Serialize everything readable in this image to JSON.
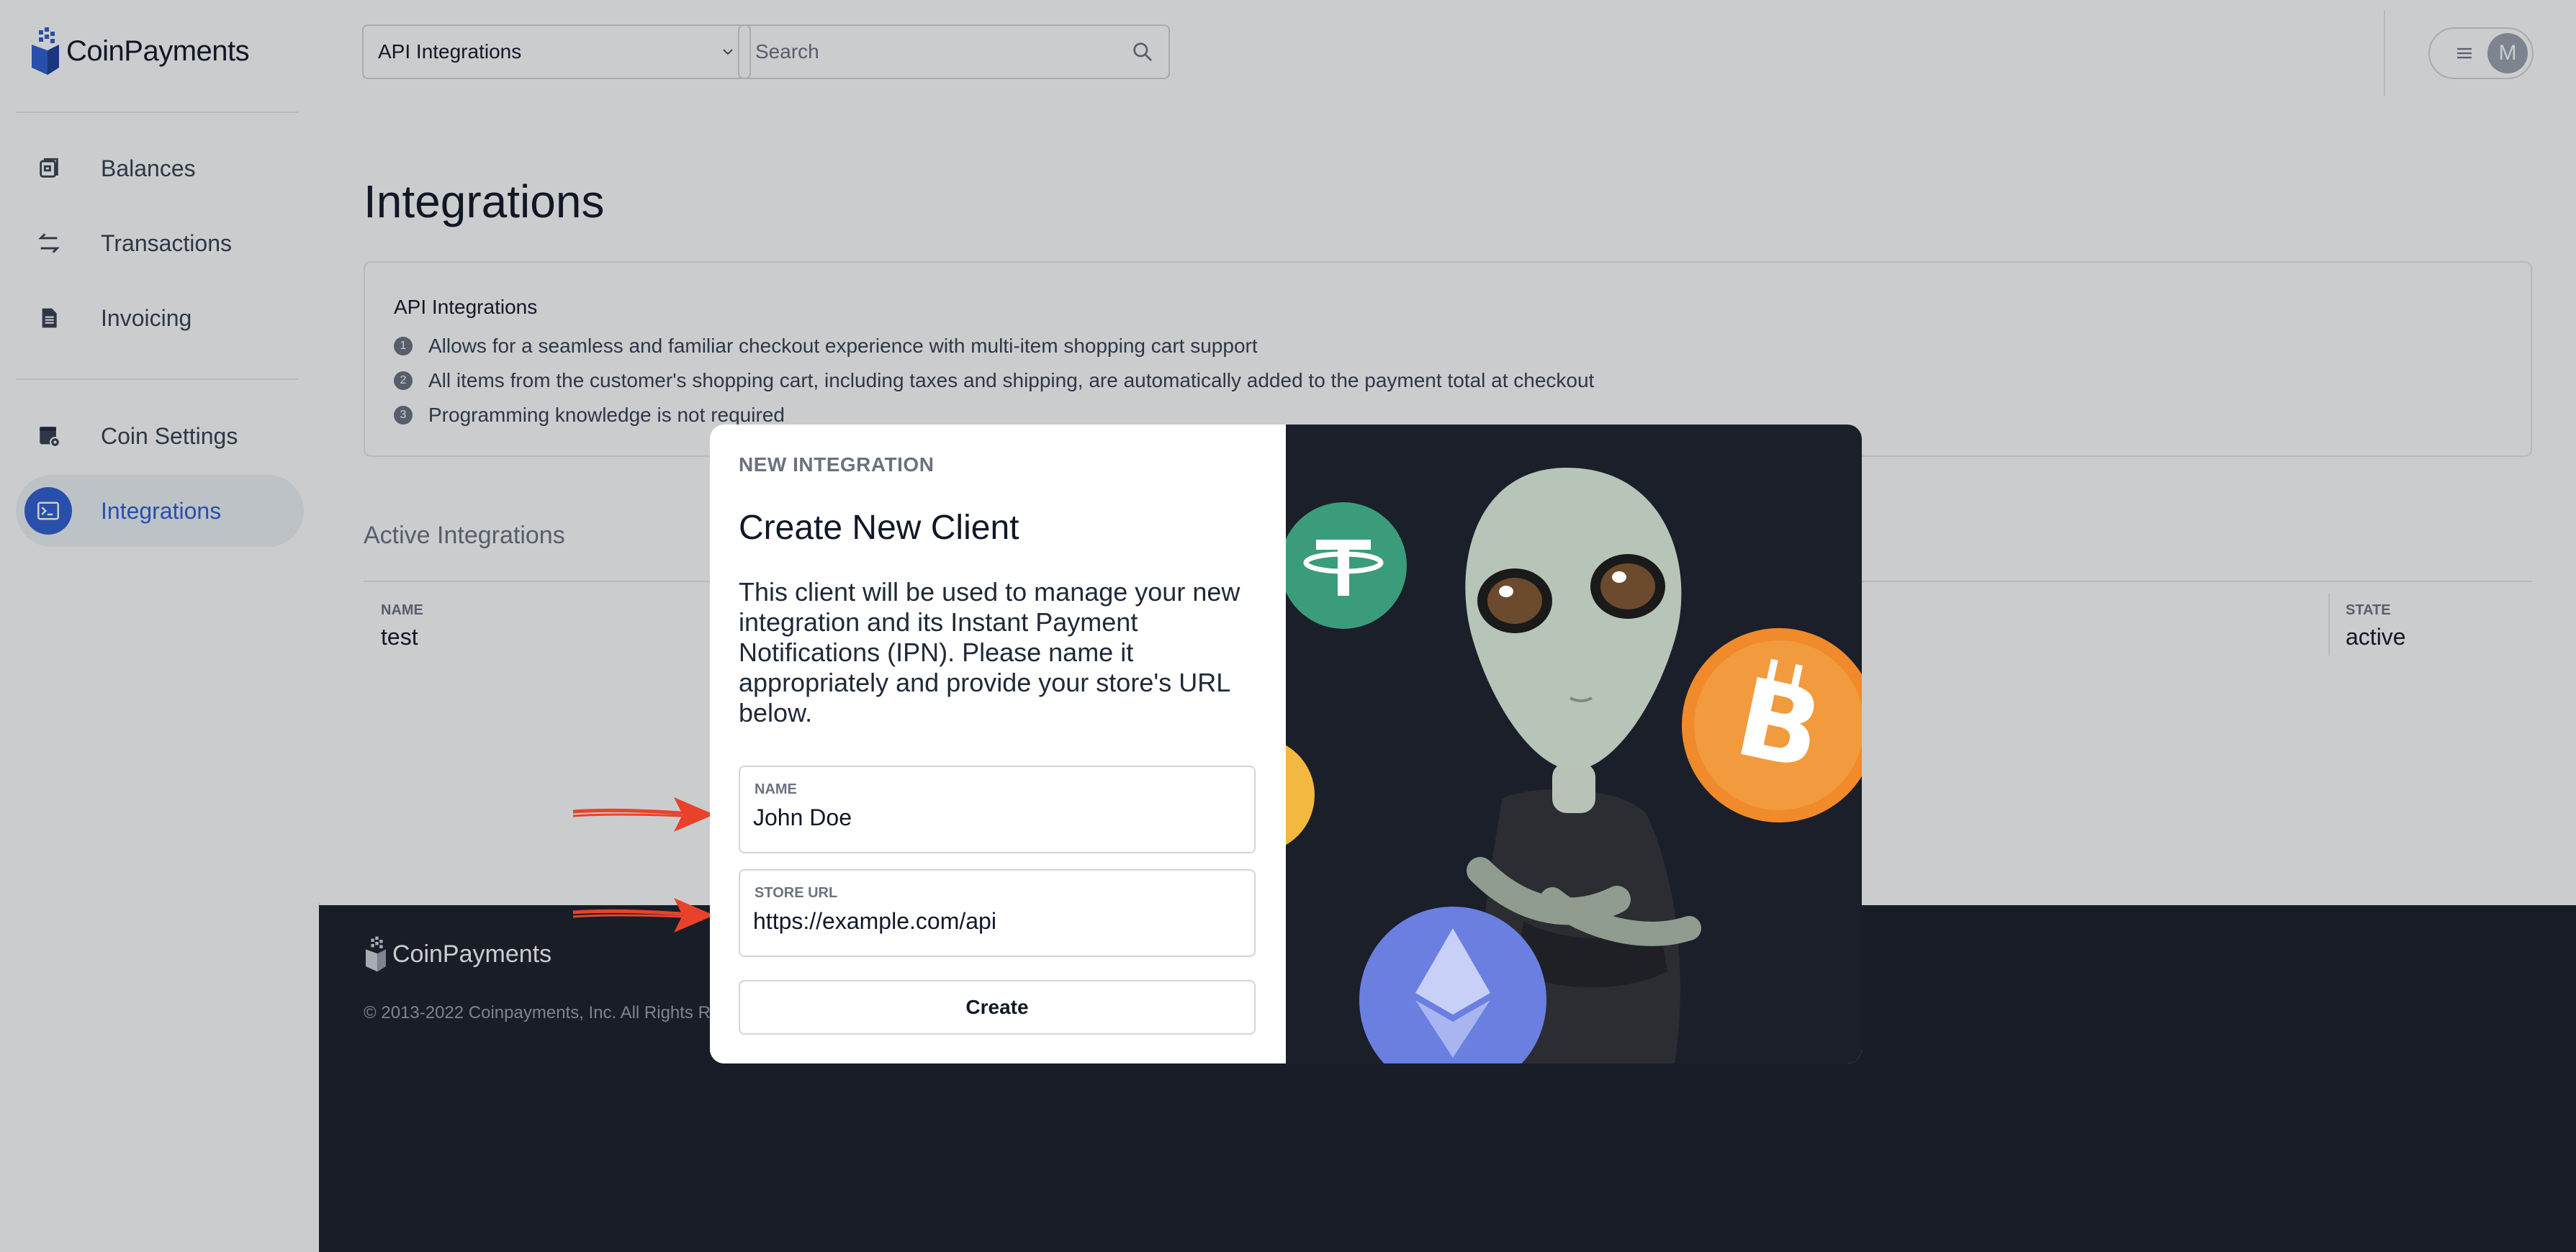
{
  "brand": {
    "name": "CoinPayments"
  },
  "sidebar": {
    "items": [
      {
        "label": "Balances",
        "icon": "wallet-icon"
      },
      {
        "label": "Transactions",
        "icon": "transfer-arrows-icon"
      },
      {
        "label": "Invoicing",
        "icon": "document-icon"
      },
      {
        "label": "Coin Settings",
        "icon": "coin-settings-icon"
      },
      {
        "label": "Integrations",
        "icon": "terminal-icon",
        "active": true
      }
    ]
  },
  "topbar": {
    "section_select": "API Integrations",
    "search_placeholder": "Search",
    "avatar_initial": "M"
  },
  "main": {
    "title": "Integrations",
    "info": {
      "title": "API Integrations",
      "items": [
        {
          "num": "1",
          "text": "Allows for a seamless and familiar checkout experience with multi-item shopping cart support"
        },
        {
          "num": "2",
          "text": "All items from the customer's shopping cart, including taxes and shipping, are automatically added to the payment total at checkout"
        },
        {
          "num": "3",
          "text": "Programming knowledge is not required"
        }
      ]
    },
    "active": {
      "title": "Active Integrations",
      "name_header": "NAME",
      "name_value": "test",
      "state_header": "STATE",
      "state_value": "active"
    }
  },
  "footer": {
    "brand": "CoinPayments",
    "copyright": "© 2013-2022 Coinpayments, Inc. All Rights Re"
  },
  "modal": {
    "eyebrow": "NEW INTEGRATION",
    "title": "Create New Client",
    "description": "This client will be used to manage your new integration and its Instant Payment Notifications (IPN). Please name it appropriately and provide your store's URL below.",
    "name_label": "NAME",
    "name_value": "John Doe",
    "url_label": "STORE URL",
    "url_value": "https://example.com/api",
    "create_label": "Create"
  },
  "colors": {
    "accent": "#2f5fd1",
    "footer_bg": "#1b1f2a",
    "annotation_arrow": "#e8432a",
    "tether": "#3a9c7a",
    "bitcoin": "#f08a2a",
    "ethereum": "#6a7fe0"
  }
}
